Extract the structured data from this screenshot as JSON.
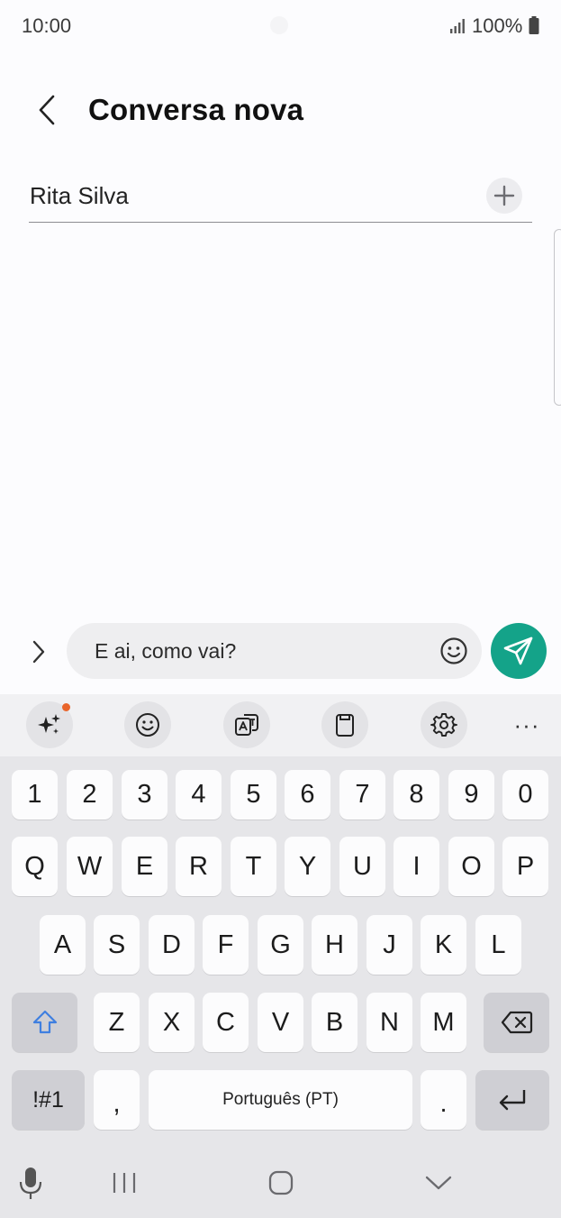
{
  "status_bar": {
    "time": "10:00",
    "battery": "100%",
    "icons": [
      "signal-icon",
      "battery-icon"
    ]
  },
  "header": {
    "title": "Conversa nova",
    "back_icon": "chevron-left-icon"
  },
  "recipient": {
    "name": "Rita Silva",
    "add_icon": "plus-icon"
  },
  "composer": {
    "message": "E ai, como vai?",
    "send_icon": "paper-plane-icon",
    "emoji_icon": "smiley-icon",
    "expand_icon": "chevron-right-icon"
  },
  "keyboard_toolbar": {
    "items": [
      "sparkle-icon",
      "emoji-icon",
      "translate-icon",
      "clipboard-icon",
      "settings-icon",
      "more-icon"
    ],
    "more_label": "···"
  },
  "keyboard": {
    "row_numbers": [
      "1",
      "2",
      "3",
      "4",
      "5",
      "6",
      "7",
      "8",
      "9",
      "0"
    ],
    "row_1": [
      "Q",
      "W",
      "E",
      "R",
      "T",
      "Y",
      "U",
      "I",
      "O",
      "P"
    ],
    "row_2": [
      "A",
      "S",
      "D",
      "F",
      "G",
      "H",
      "J",
      "K",
      "L"
    ],
    "row_3": [
      "Z",
      "X",
      "C",
      "V",
      "B",
      "N",
      "M"
    ],
    "symbols_label": "!#1",
    "comma": ",",
    "space_label": "Português (PT)",
    "period": ".",
    "shift_icon": "shift-icon",
    "backspace_icon": "backspace-icon",
    "enter_icon": "enter-icon"
  },
  "nav_bar": {
    "items": [
      "microphone-icon",
      "recents-icon",
      "home-icon",
      "hide-keyboard-icon"
    ]
  },
  "colors": {
    "accent": "#14a389",
    "notification_dot": "#e9652b",
    "shift_blue": "#3f7fe0"
  }
}
